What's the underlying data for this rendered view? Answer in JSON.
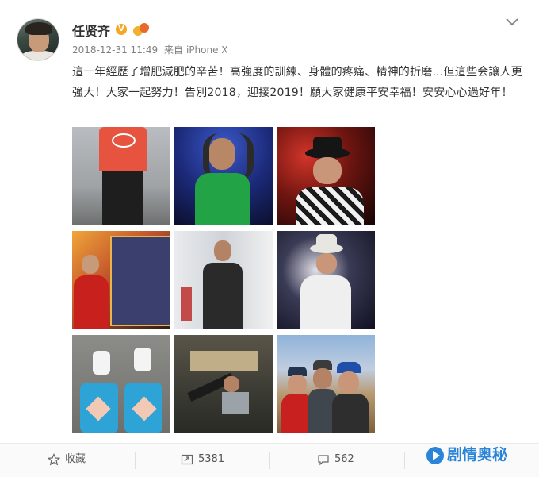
{
  "post": {
    "author": "任贤齐",
    "verified_badge": "V",
    "date": "2018-12-31 11:49",
    "source_prefix": "来自",
    "source_device": "iPhone X",
    "text": "這一年經歷了增肥減肥的辛苦！高強度的訓練、身體的疼痛、精神的折磨…但這些会讓人更強大！大家一起努力！告別2018，迎接2019！願大家健康平安幸福！安安心心過好年！",
    "photo_count": 9
  },
  "actions": {
    "favorite_label": "收藏",
    "repost_count": "5381",
    "comment_count": "562"
  },
  "watermark": {
    "text": "剧情奥秘"
  },
  "colors": {
    "text": "#333333",
    "meta": "#808080",
    "badge": "#f5a623",
    "watermark": "#2a84d8"
  }
}
